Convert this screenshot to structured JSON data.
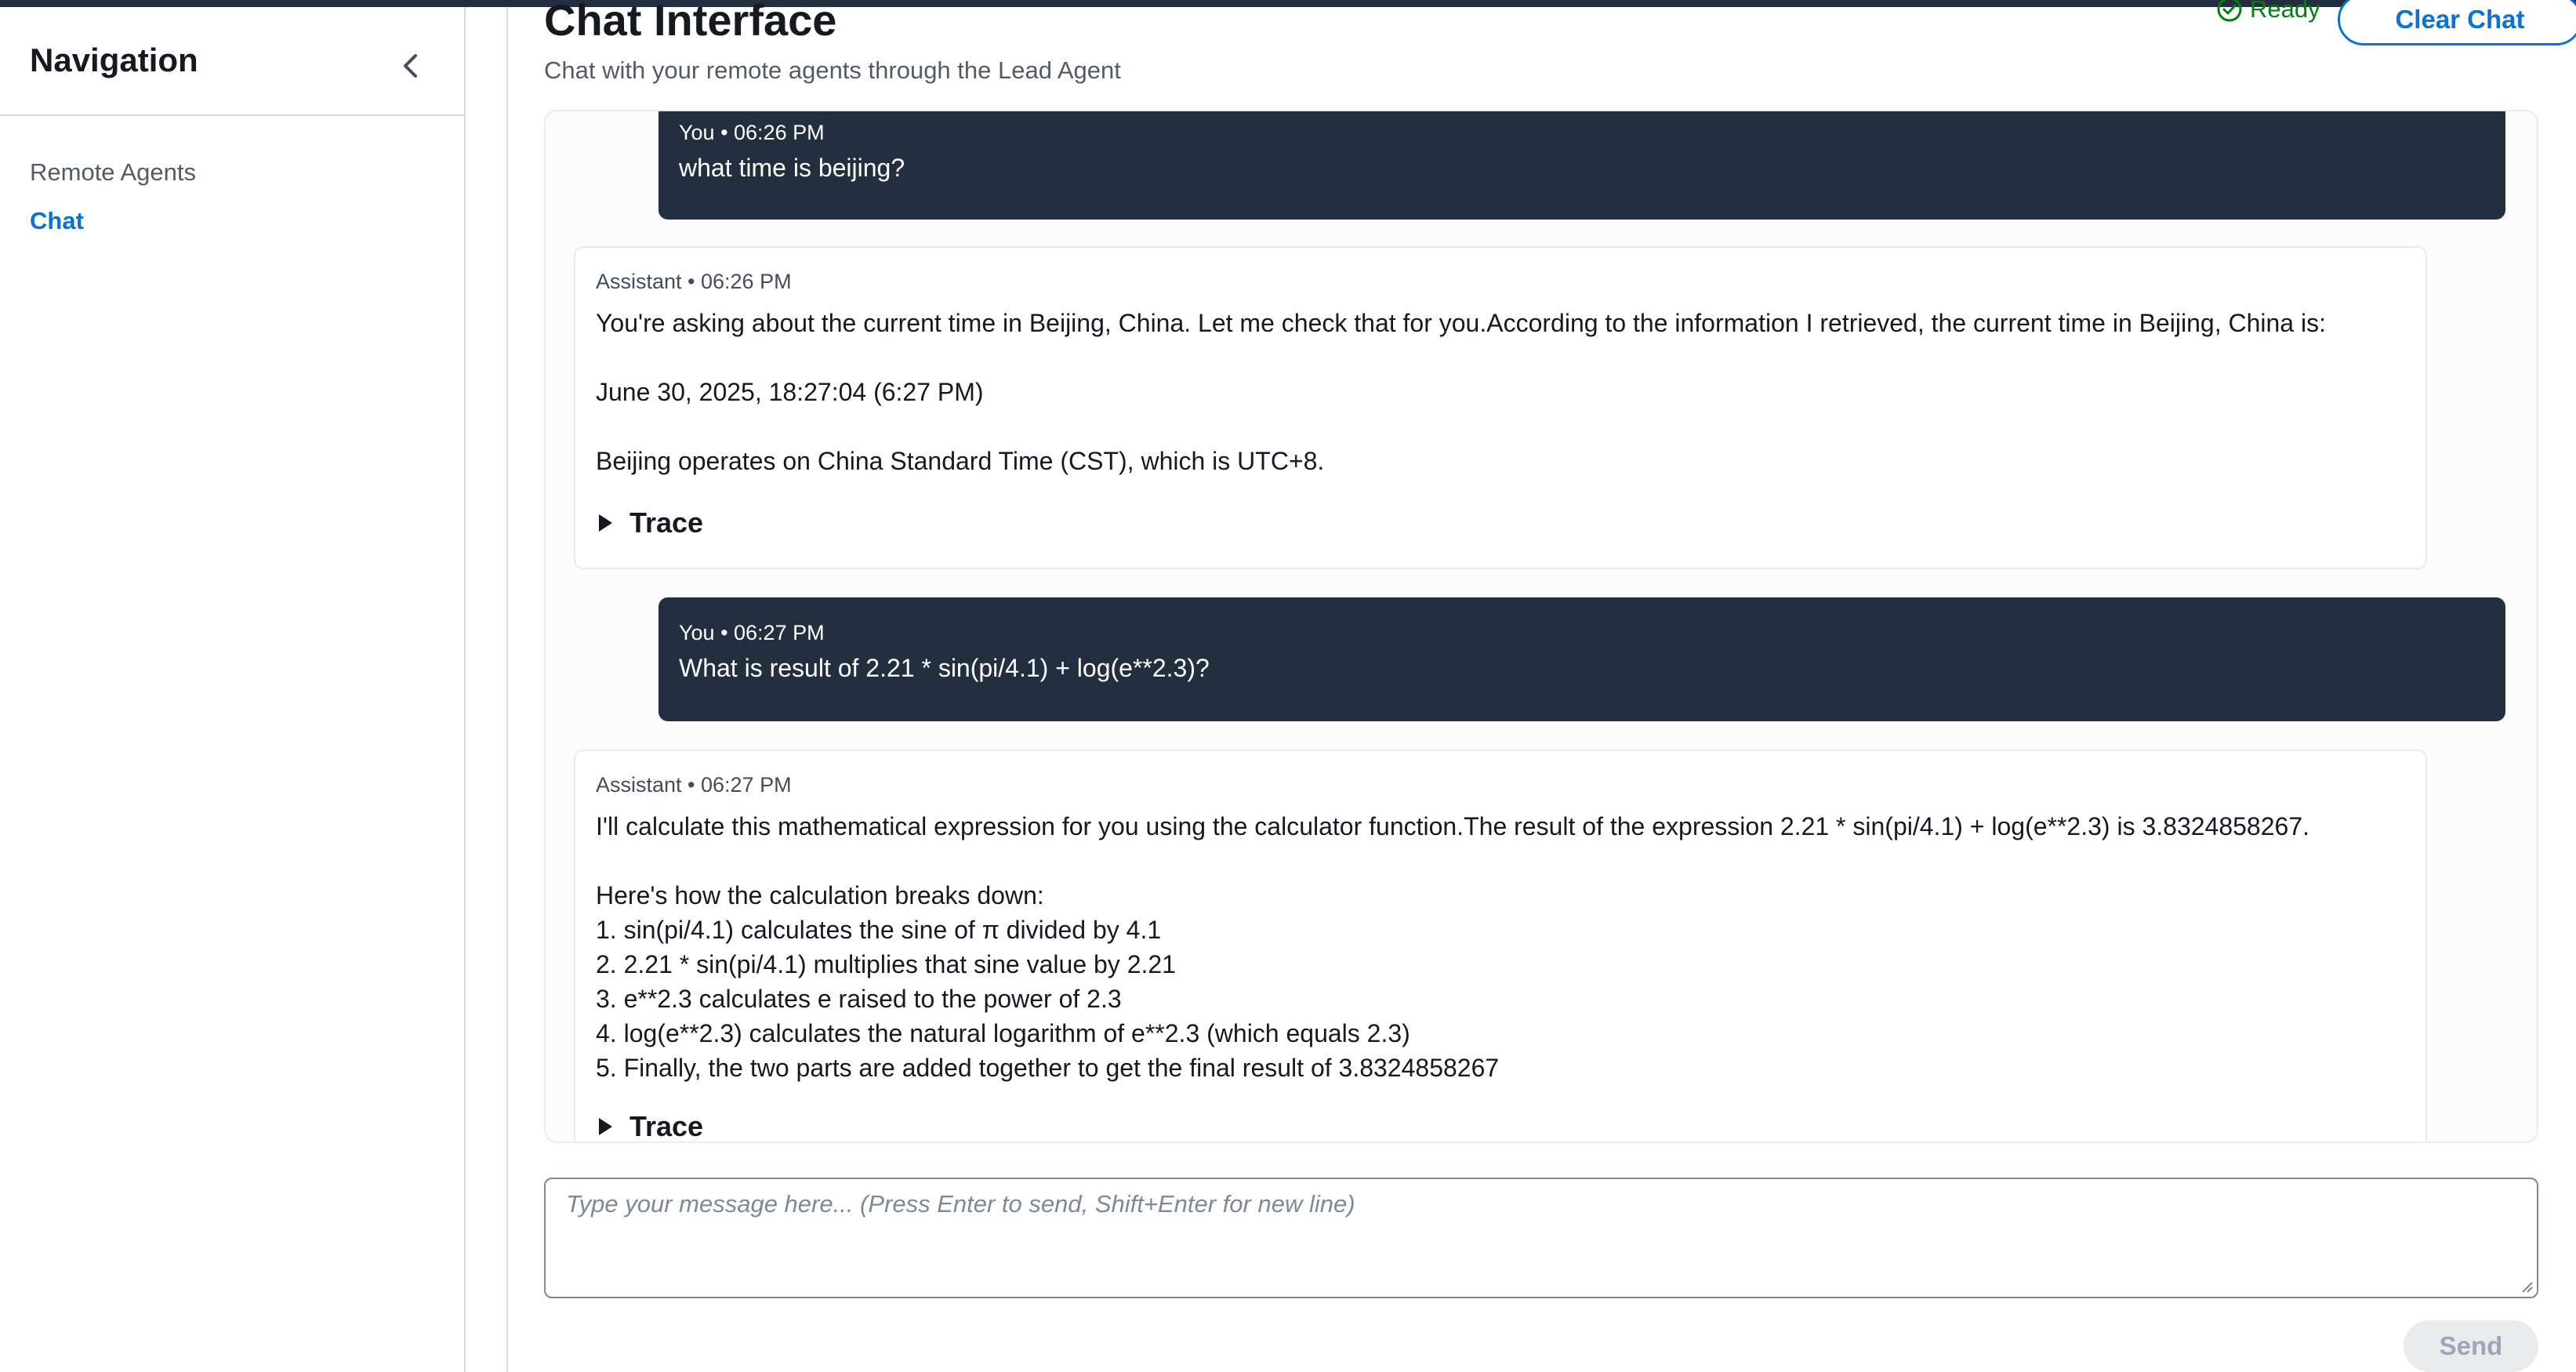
{
  "sidebar": {
    "title": "Navigation",
    "items": [
      {
        "label": "Remote Agents"
      },
      {
        "label": "Chat"
      }
    ]
  },
  "header": {
    "title": "Chat Interface",
    "subtitle": "Chat with your remote agents through the Lead Agent",
    "status": "Ready",
    "clear_label": "Clear Chat"
  },
  "messages": [
    {
      "meta": "You • 06:26 PM",
      "text": "what time is beijing?"
    },
    {
      "meta": "Assistant • 06:26 PM",
      "text": "You're asking about the current time in Beijing, China. Let me check that for you.According to the information I retrieved, the current time in Beijing, China is:\n\nJune 30, 2025, 18:27:04 (6:27 PM)\n\nBeijing operates on China Standard Time (CST), which is UTC+8.",
      "trace_label": "Trace"
    },
    {
      "meta": "You • 06:27 PM",
      "text": "What is result of 2.21 * sin(pi/4.1) + log(e**2.3)?"
    },
    {
      "meta": "Assistant • 06:27 PM",
      "text": "I'll calculate this mathematical expression for you using the calculator function.The result of the expression 2.21 * sin(pi/4.1) + log(e**2.3) is 3.8324858267.\n\nHere's how the calculation breaks down:\n1. sin(pi/4.1) calculates the sine of π divided by 4.1\n2. 2.21 * sin(pi/4.1) multiplies that sine value by 2.21\n3. e**2.3 calculates e raised to the power of 2.3\n4. log(e**2.3) calculates the natural logarithm of e**2.3 (which equals 2.3)\n5. Finally, the two parts are added together to get the final result of 3.8324858267",
      "trace_label": "Trace"
    }
  ],
  "composer": {
    "placeholder": "Type your message here... (Press Enter to send, Shift+Enter for new line)",
    "send_label": "Send"
  },
  "colors": {
    "accent": "#0972d3",
    "user_bubble": "#232f3e",
    "status_ok": "#037f0c"
  },
  "icons": [
    "chevron-left-icon",
    "check-circle-icon",
    "caret-right-icon"
  ]
}
